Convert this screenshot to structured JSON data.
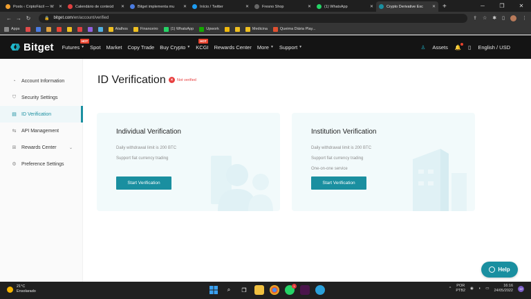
{
  "browser": {
    "tabs": [
      {
        "title": "Posts ‹ CriptoFácil — W",
        "color": "#f0a030",
        "active": false
      },
      {
        "title": "Calendário de conteúd",
        "color": "#e04040",
        "active": false
      },
      {
        "title": "Bitget implementa mu",
        "color": "#4a7be0",
        "active": false
      },
      {
        "title": "Início / Twitter",
        "color": "#1d9bf0",
        "active": false
      },
      {
        "title": "Fresno Shop",
        "color": "#666666",
        "active": false
      },
      {
        "title": "(1) WhatsApp",
        "color": "#25d366",
        "active": false
      },
      {
        "title": "Crypto Derivative Exc",
        "color": "#1a8fa0",
        "active": true
      }
    ],
    "new_tab": "+",
    "url_host": "bitget.com",
    "url_path": "/en/account/verified"
  },
  "bookmarks": [
    {
      "label": "Apps",
      "color": "#888888"
    },
    {
      "label": "",
      "color": "#e04a4a"
    },
    {
      "label": "",
      "color": "#4a7be0"
    },
    {
      "label": "",
      "color": "#e0a040"
    },
    {
      "label": "",
      "color": "#ea4335"
    },
    {
      "label": "",
      "color": "#f0c020"
    },
    {
      "label": "",
      "color": "#e04040"
    },
    {
      "label": "",
      "color": "#9060e0"
    },
    {
      "label": "",
      "color": "#50b0e0"
    },
    {
      "label": "Atalhos",
      "color": "#f0c020"
    },
    {
      "label": "Financeiro",
      "color": "#f0c020"
    },
    {
      "label": "(1) WhatsApp",
      "color": "#25d366"
    },
    {
      "label": "Upwork",
      "color": "#14a800"
    },
    {
      "label": "",
      "color": "#f0b90b"
    },
    {
      "label": "",
      "color": "#f0c020"
    },
    {
      "label": "Medicina",
      "color": "#f0c020"
    },
    {
      "label": "Queima Diária Play...",
      "color": "#e05030"
    }
  ],
  "header": {
    "logo": "Bitget",
    "nav": [
      {
        "label": "Futures",
        "hot": true,
        "caret": true
      },
      {
        "label": "Spot",
        "hot": false,
        "caret": false
      },
      {
        "label": "Market",
        "hot": false,
        "caret": false
      },
      {
        "label": "Copy Trade",
        "hot": false,
        "caret": false
      },
      {
        "label": "Buy Crypto",
        "hot": false,
        "caret": true
      },
      {
        "label": "KCGI",
        "hot": true,
        "caret": false
      },
      {
        "label": "Rewards Center",
        "hot": false,
        "caret": false
      },
      {
        "label": "More",
        "hot": false,
        "caret": true
      },
      {
        "label": "Support",
        "hot": false,
        "caret": true
      }
    ],
    "hot_label": "HOT",
    "assets": "Assets",
    "language": "English / USD"
  },
  "sidebar": {
    "items": [
      {
        "label": "Account Information",
        "icon": "user-icon",
        "glyph": "◔",
        "active": false
      },
      {
        "label": "Security Settings",
        "icon": "shield-icon",
        "glyph": "⛉",
        "active": false
      },
      {
        "label": "ID Verification",
        "icon": "id-card-icon",
        "glyph": "▤",
        "active": true
      },
      {
        "label": "API Management",
        "icon": "api-icon",
        "glyph": "⇆",
        "active": false
      },
      {
        "label": "Rewards Center",
        "icon": "gift-icon",
        "glyph": "⊞",
        "active": false
      },
      {
        "label": "Preference Settings",
        "icon": "gear-icon",
        "glyph": "⚙",
        "active": false
      }
    ]
  },
  "main": {
    "title": "ID Verification",
    "status": "Not verified",
    "cards": [
      {
        "title": "Individual Verification",
        "lines": [
          "Daily withdrawal limit is 200 BTC",
          "Support fiat currency trading"
        ],
        "button": "Start Verification"
      },
      {
        "title": "Institution Verification",
        "lines": [
          "Daily withdrawal limit is 200 BTC",
          "Support fiat currency trading",
          "One-on-one service"
        ],
        "button": "Start Verification"
      }
    ]
  },
  "help": {
    "label": "Help"
  },
  "taskbar": {
    "temperature": "21°C",
    "weather": "Ensolarado",
    "lang1": "POR",
    "lang2": "PTB2",
    "time": "16:16",
    "date": "24/05/2022",
    "notification_count": "12",
    "whatsapp_badge": "1"
  },
  "colors": {
    "accent": "#1a8fa0",
    "error": "#e84040",
    "header_bg": "#141414"
  }
}
